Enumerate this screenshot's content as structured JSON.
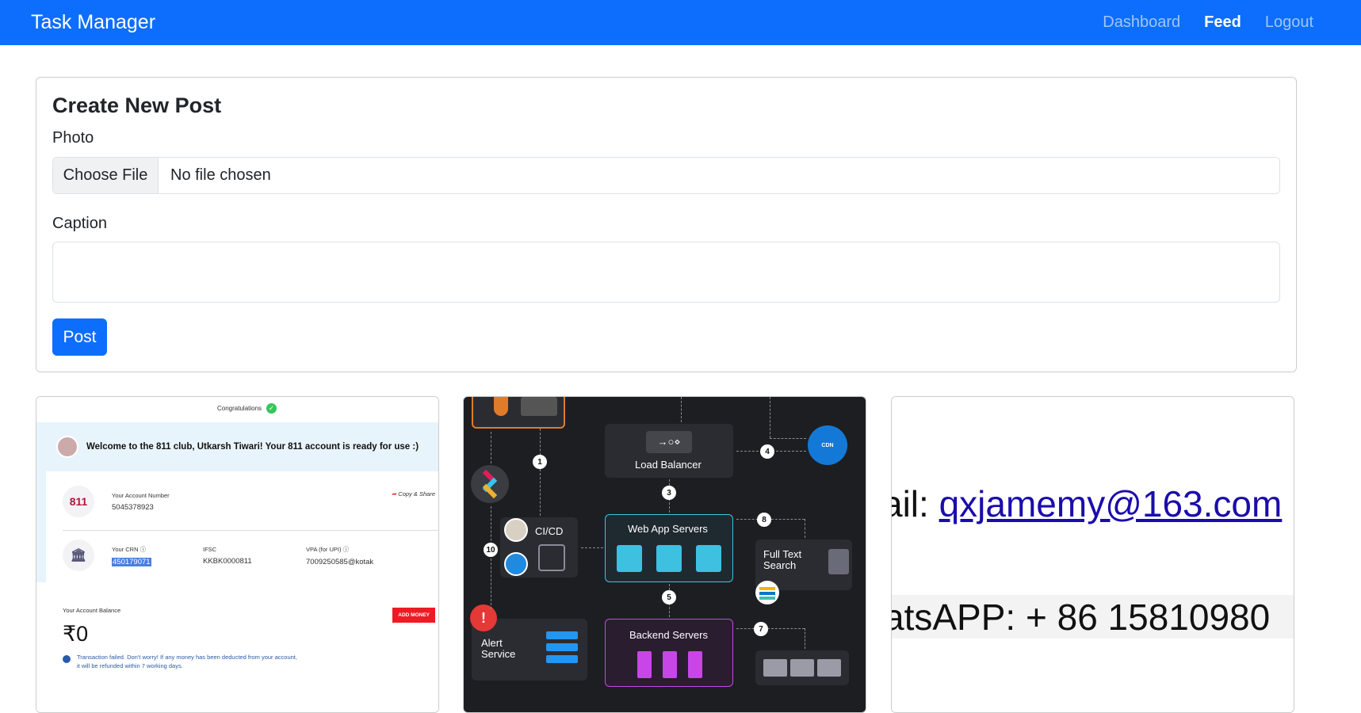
{
  "navbar": {
    "brand": "Task Manager",
    "links": [
      {
        "label": "Dashboard",
        "active": false
      },
      {
        "label": "Feed",
        "active": true
      },
      {
        "label": "Logout",
        "active": false
      }
    ]
  },
  "create_post": {
    "title": "Create New Post",
    "photo_label": "Photo",
    "choose_file": "Choose File",
    "file_status": "No file chosen",
    "caption_label": "Caption",
    "caption_value": "",
    "post_button": "Post"
  },
  "posts": [
    {
      "bank": {
        "congrats": "Congratulations",
        "welcome": "Welcome to the 811 club, Utkarsh Tiwari! Your 811 account is ready for use :)",
        "logo_text": "811",
        "account_number_label": "Your Account Number",
        "account_number": "5045378923",
        "copy_share": "Copy & Share",
        "crn_label": "Your CRN",
        "crn": "450179071",
        "ifsc_label": "IFSC",
        "ifsc": "KKBK0000811",
        "vpa_label": "VPA (for UPI)",
        "vpa": "7009250585@kotak",
        "balance_label": "Your Account Balance",
        "balance": "₹0",
        "add_money": "ADD MONEY",
        "failure_note": "Transaction failed. Don't worry! If any money has been deducted from your account, it will be refunded within 7 working days."
      }
    },
    {
      "diagram": {
        "load_balancer": "Load Balancer",
        "cdn": "CDN",
        "cicd": "CI/CD",
        "web_app_servers": "Web App Servers",
        "full_text_search": "Full Text Search",
        "backend_servers": "Backend Servers",
        "alert_service": "Alert Service",
        "steps": [
          "1",
          "3",
          "4",
          "5",
          "7",
          "8",
          "10"
        ]
      }
    },
    {
      "email": {
        "line1_prefix": "ail: ",
        "line1_link": "qxjamemy@163.com",
        "line2": "atsAPP: + 86 15810980"
      }
    }
  ],
  "colors": {
    "primary": "#0d6efd",
    "diagram_bg": "#1d1e22",
    "web_app_border": "#38c7d8",
    "backend_border": "#c846e8",
    "alert_red": "#e53935"
  }
}
